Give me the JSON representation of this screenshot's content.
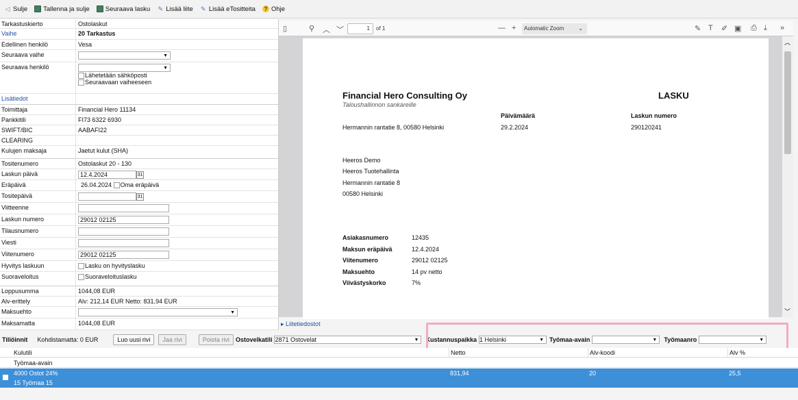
{
  "toolbar": {
    "back_label": "Sulje",
    "save_close_label": "Tallenna ja sulje",
    "next_invoice_label": "Seuraava lasku",
    "add_attachment_label": "Lisää liite",
    "add_evoucher_label": "Lisää eTositteita",
    "help_label": "Ohje"
  },
  "form": {
    "tarkastuskierto": {
      "label": "Tarkastuskierto",
      "value": "Ostolaskut"
    },
    "vaihe": {
      "label": "Vaihe",
      "value": "20 Tarkastus"
    },
    "edellinen": {
      "label": "Edellinen henkilö",
      "value": "Vesa"
    },
    "seuraava_vaihe": {
      "label": "Seuraava vaihe",
      "value": ""
    },
    "seuraava_henkilo": {
      "label": "Seuraava henkilö",
      "value": "",
      "cb1": "Lähetetään sähköposti",
      "cb2": "Seuraavaan vaiheeseen"
    },
    "lisatiedot": {
      "label": "Lisätiedot"
    },
    "toimittaja": {
      "label": "Toimittaja",
      "value": "Financial Hero 11134"
    },
    "pankkitili": {
      "label": "Pankkitili",
      "value": "FI73 6322 6930"
    },
    "swift": {
      "label": "SWIFT/BIC",
      "value": "AABAFI22"
    },
    "clearing": {
      "label": "CLEARING",
      "value": ""
    },
    "kulujen": {
      "label": "Kulujen maksaja",
      "value": "Jaetut kulut (SHA)"
    },
    "tositenumero": {
      "label": "Tositenumero",
      "value": "Ostolaskut 20 - 130"
    },
    "laskun_paiva": {
      "label": "Laskun päivä",
      "value": "12.4.2024",
      "cal": "31"
    },
    "erapaiva": {
      "label": "Eräpäivä",
      "value": "26.04.2024",
      "check": "Oma eräpäivä"
    },
    "tositepaiva": {
      "label": "Tositepäivä",
      "value": "",
      "cal": "31"
    },
    "viitteenne": {
      "label": "Viitteenne",
      "value": ""
    },
    "laskun_numero": {
      "label": "Laskun numero",
      "value": "29012 02125"
    },
    "tilausnumero": {
      "label": "Tilausnumero",
      "value": ""
    },
    "viesti": {
      "label": "Viesti",
      "value": ""
    },
    "viitenumero": {
      "label": "Viitenumero",
      "value": "29012 02125"
    },
    "hyvitys": {
      "label": "Hyvitys laskuun",
      "check": "Lasku on hyvityslasku"
    },
    "suoraveloitus": {
      "label": "Suoraveloitus",
      "check": "Suoraveloituslasku"
    },
    "loppusumma": {
      "label": "Loppusumma",
      "value": "1044,08 EUR"
    },
    "alv": {
      "label": "Alv-erittely",
      "value": "Alv: 212,14 EUR  Netto: 831,94 EUR"
    },
    "maksuehto": {
      "label": "Maksuehto",
      "value": ""
    },
    "maksamatta": {
      "label": "Maksamatta",
      "value": "1044,08 EUR"
    }
  },
  "viewer": {
    "page_input": "1",
    "page_count": "of 1",
    "zoom": "Automatic Zoom"
  },
  "invoice": {
    "company": "Financial Hero Consulting Oy",
    "tagline": "Taloushallinnon sankareille",
    "doc_title": "LASKU",
    "date_label": "Päivämäärä",
    "number_label": "Laskun numero",
    "address": "Hermannin rantatie 8, 00580 Helsinki",
    "date": "29.2.2024",
    "number": "290120241",
    "recipient": [
      "Heeros Demo",
      "Heeros Tuotehallinta",
      "Hermannin rantatie 8",
      "00580 Helsinki"
    ],
    "details": [
      {
        "k": "Asiakasnumero",
        "v": "12435"
      },
      {
        "k": "Maksun eräpäivä",
        "v": "12.4.2024"
      },
      {
        "k": "Viitenumero",
        "v": "29012 02125"
      },
      {
        "k": "Maksuehto",
        "v": "14 pv netto"
      },
      {
        "k": "Viivästyskorko",
        "v": "7%"
      }
    ]
  },
  "attachment_link": "Liitetiedostot",
  "entries_bar": {
    "title": "Tiliöinnit",
    "match": "Kohdistamatta: 0 EUR",
    "new_row": "Luo uusi rivi",
    "copy_row": "Jaa rivi",
    "delete_row": "Poista rivi",
    "ostovelkatili_label": "Ostovelkatili",
    "ostovelkatili_value": "2871 Ostovelat",
    "kustannus_label": "Kustannuspaikka",
    "kustannus_value": "1 Helsinki",
    "tyomaa_label": "Työmaa-avain",
    "tyomaa_value": "",
    "tyomaanro_label": "Työmaanro",
    "tyomaanro_value": ""
  },
  "grid": {
    "headers": {
      "kulutili": "Kulutili",
      "netto": "Netto",
      "alv_koodi": "Alv-koodi",
      "alv_pct": "Alv %"
    },
    "subheader": "Työmaa-avain",
    "row": {
      "kulutili": "4000 Ostot 24%",
      "netto": "831,94",
      "alv_koodi": "20",
      "alv_pct": "25,5",
      "tyomaa": "15 Työmaa 15"
    }
  }
}
